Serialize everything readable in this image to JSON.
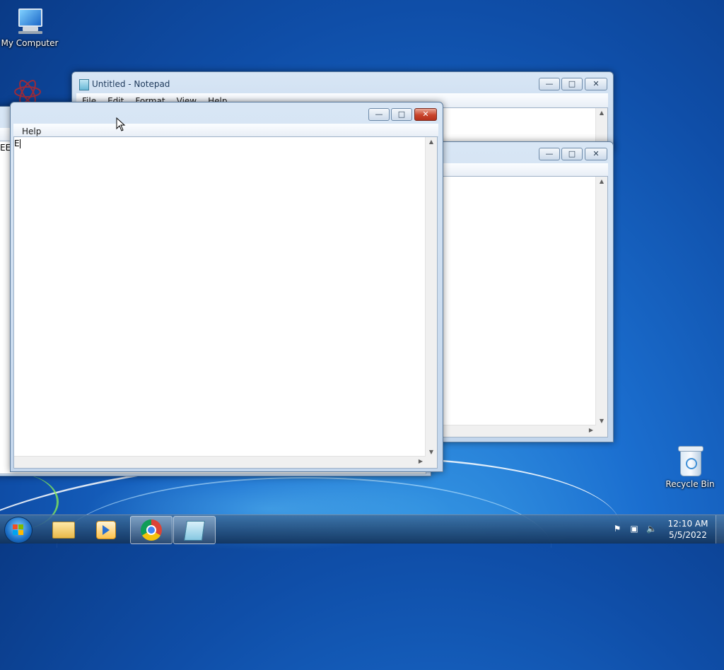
{
  "desktop": {
    "icons": [
      {
        "label": "My Computer",
        "icon": "computer-icon"
      },
      {
        "label": "Recycle Bin",
        "icon": "recycle-bin-icon"
      }
    ]
  },
  "notepad_back": {
    "title": "Untitled - Notepad",
    "menu": [
      "File",
      "Edit",
      "Format",
      "View",
      "Help"
    ]
  },
  "notepad_mid": {
    "title": "",
    "menu": []
  },
  "notepad_front": {
    "title": "",
    "menu": [
      "Help"
    ],
    "content": "E"
  },
  "notepad_left": {
    "menu_fragment": "H",
    "content": "EE"
  },
  "taskbar": {
    "start_icon": "windows-start-icon",
    "pinned": [
      "file-explorer-icon",
      "media-player-icon",
      "chrome-icon",
      "notepad-icon"
    ],
    "clock_time": "12:10 AM",
    "clock_date": "5/5/2022",
    "tray_icons": [
      "action-center-flag-icon",
      "network-icon",
      "volume-icon"
    ]
  },
  "colors": {
    "close_button": "#c9452c",
    "titlebar": "#c3d6ec"
  }
}
